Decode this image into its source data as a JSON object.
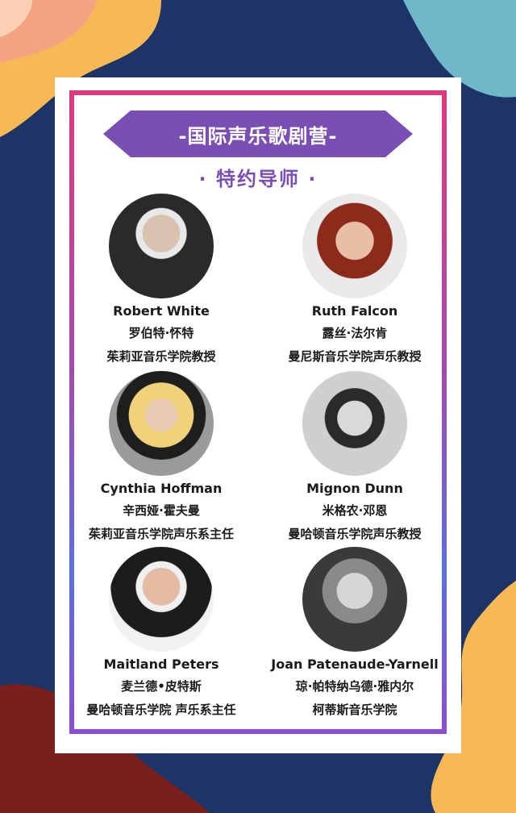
{
  "colors": {
    "background": "#1c3466",
    "banner": "#7a4fb3",
    "accent_pink": "#e0397f",
    "accent_blue": "#5b6fe0"
  },
  "banner": {
    "title": "-国际声乐歌剧营-"
  },
  "subtitle": "· 特约导师 ·",
  "mentors": [
    {
      "name_en": "Robert White",
      "name_cn": "罗伯特·怀特",
      "title": "茱莉亚音乐学院教授"
    },
    {
      "name_en": "Ruth Falcon",
      "name_cn": "露丝·法尔肯",
      "title": "曼尼斯音乐学院声乐教授"
    },
    {
      "name_en": "Cynthia Hoffman",
      "name_cn": "辛西娅·霍夫曼",
      "title": "茱莉亚音乐学院声乐系主任"
    },
    {
      "name_en": "Mignon Dunn",
      "name_cn": "米格农·邓恩",
      "title": "曼哈顿音乐学院声乐教授"
    },
    {
      "name_en": "Maitland Peters",
      "name_cn": "麦兰德•皮特斯",
      "title": "曼哈顿音乐学院 声乐系主任"
    },
    {
      "name_en": "Joan Patenaude-Yarnell",
      "name_cn": "琼·帕特纳乌德·雅内尔",
      "title": "柯蒂斯音乐学院"
    }
  ]
}
